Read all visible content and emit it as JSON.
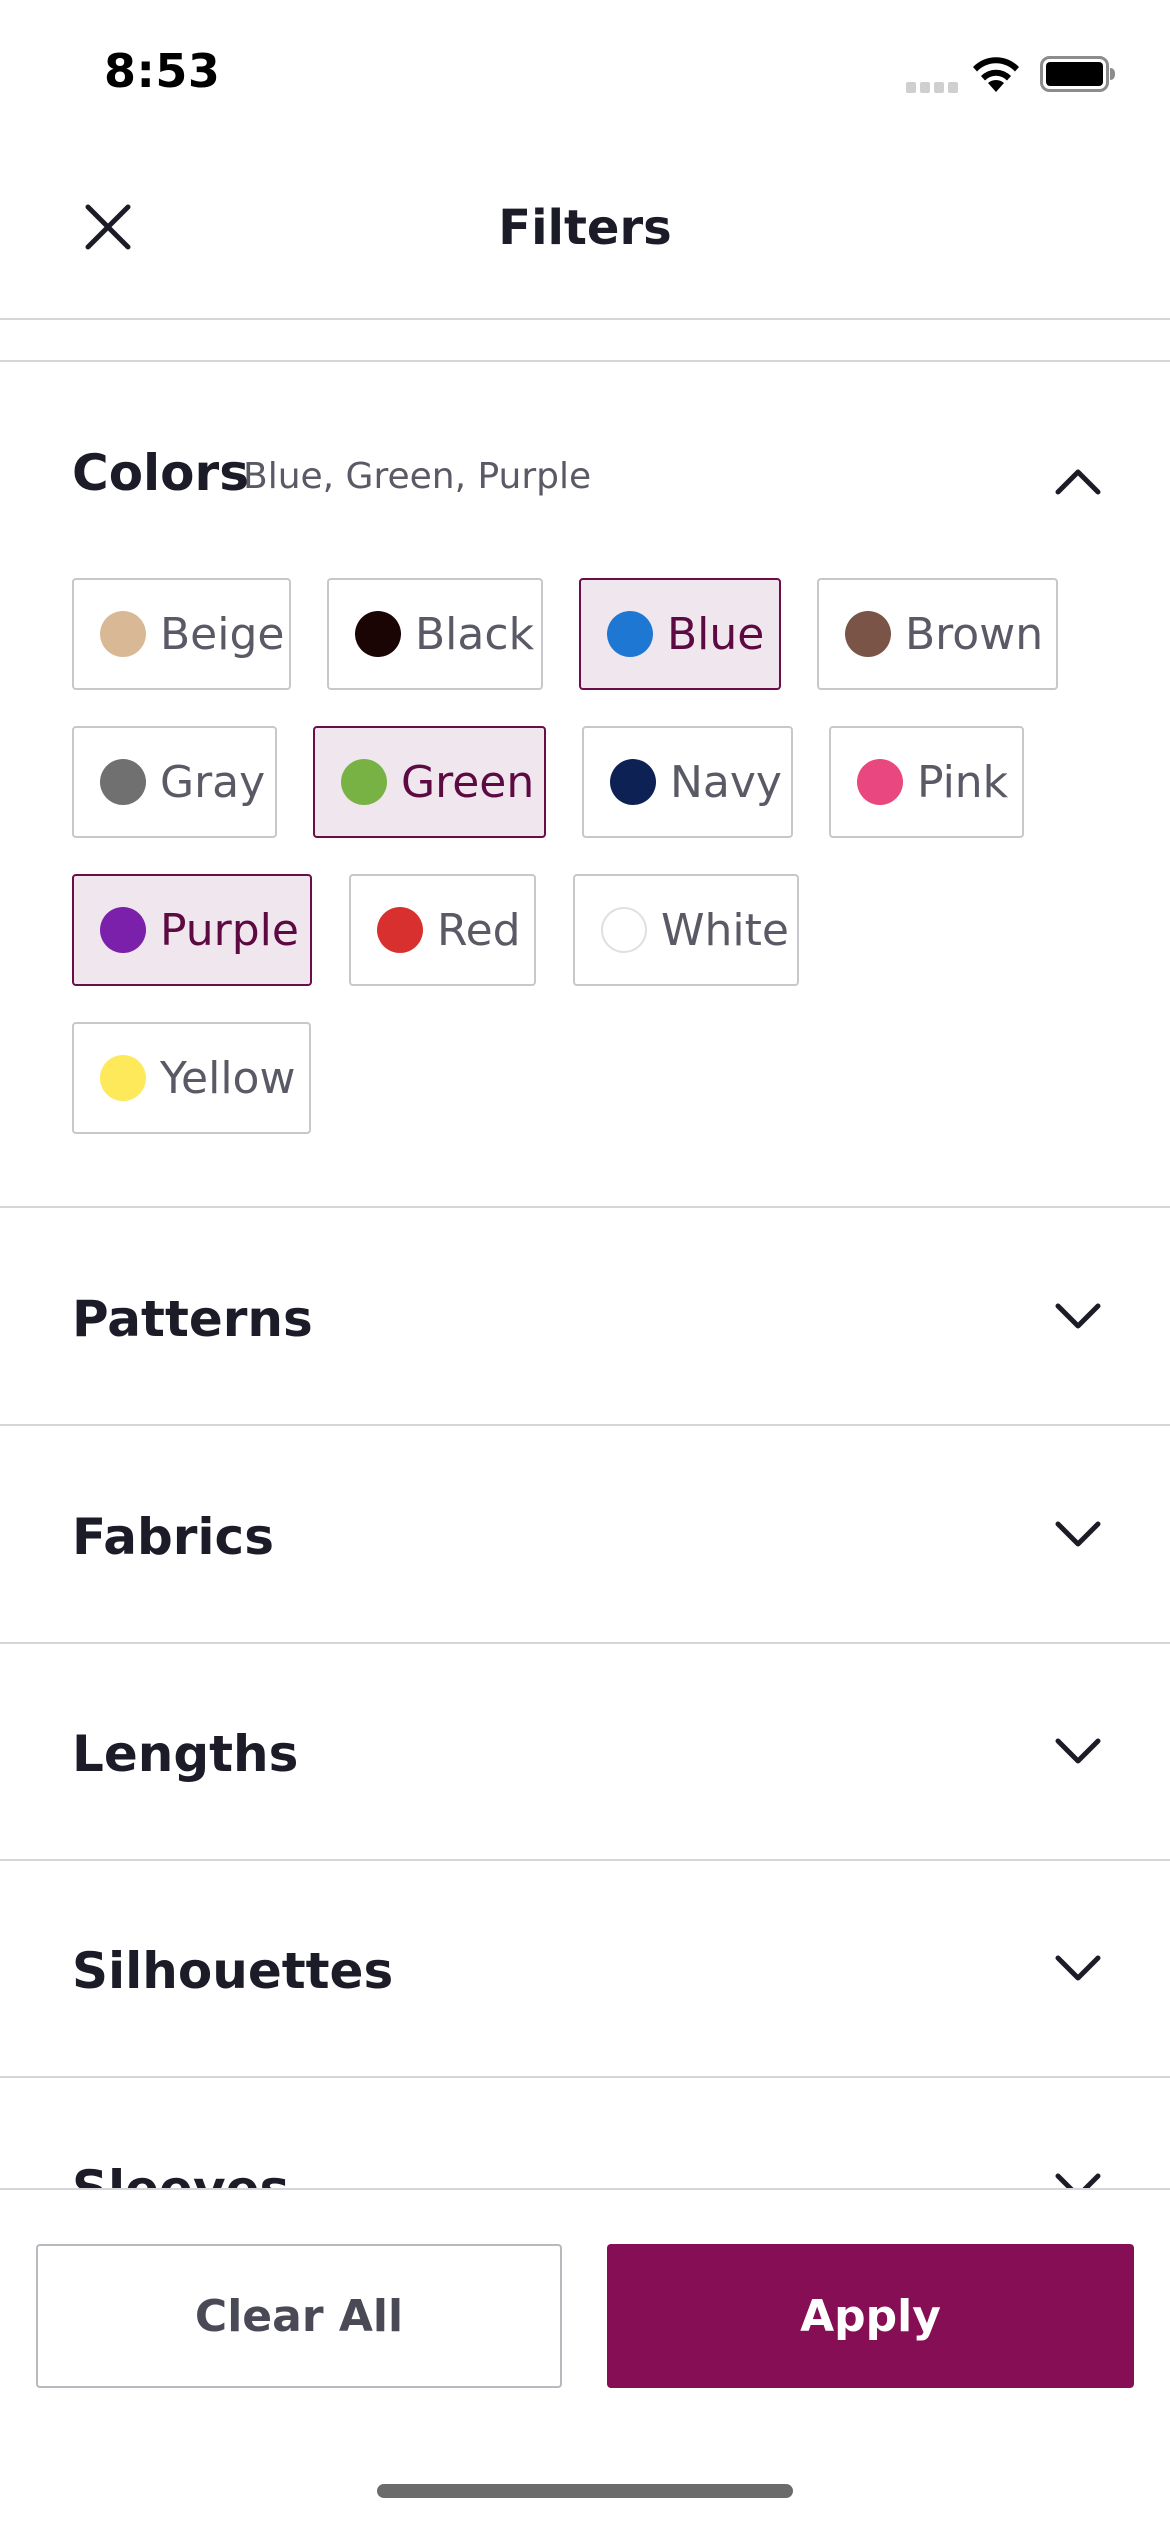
{
  "status_bar": {
    "time": "8:53"
  },
  "header": {
    "title": "Filters",
    "close_icon": "close-icon"
  },
  "colors": {
    "heading": "Colors",
    "summary": "Blue, Green, Purple",
    "expanded": true,
    "chips": [
      {
        "label": "Beige",
        "swatch": "#d9b896",
        "selected": false
      },
      {
        "label": "Black",
        "swatch": "#1a0404",
        "selected": false
      },
      {
        "label": "Blue",
        "swatch": "#1f77d4",
        "selected": true
      },
      {
        "label": "Brown",
        "swatch": "#7a5446",
        "selected": false
      },
      {
        "label": "Gray",
        "swatch": "#707070",
        "selected": false
      },
      {
        "label": "Green",
        "swatch": "#79b244",
        "selected": true
      },
      {
        "label": "Navy",
        "swatch": "#0e2154",
        "selected": false
      },
      {
        "label": "Pink",
        "swatch": "#e9477f",
        "selected": false
      },
      {
        "label": "Purple",
        "swatch": "#7b20aa",
        "selected": true
      },
      {
        "label": "Red",
        "swatch": "#d7302e",
        "selected": false
      },
      {
        "label": "White",
        "swatch": "#ffffff",
        "selected": false
      },
      {
        "label": "Yellow",
        "swatch": "#fde95a",
        "selected": false
      }
    ]
  },
  "sections": [
    {
      "label": "Patterns"
    },
    {
      "label": "Fabrics"
    },
    {
      "label": "Lengths"
    },
    {
      "label": "Silhouettes"
    },
    {
      "label": "Sleeves"
    }
  ],
  "footer": {
    "clear_label": "Clear All",
    "apply_label": "Apply"
  },
  "theme": {
    "accent": "#860e54",
    "selected_chip_bg": "#efe6ee",
    "selected_chip_border": "#6b0d4a"
  }
}
